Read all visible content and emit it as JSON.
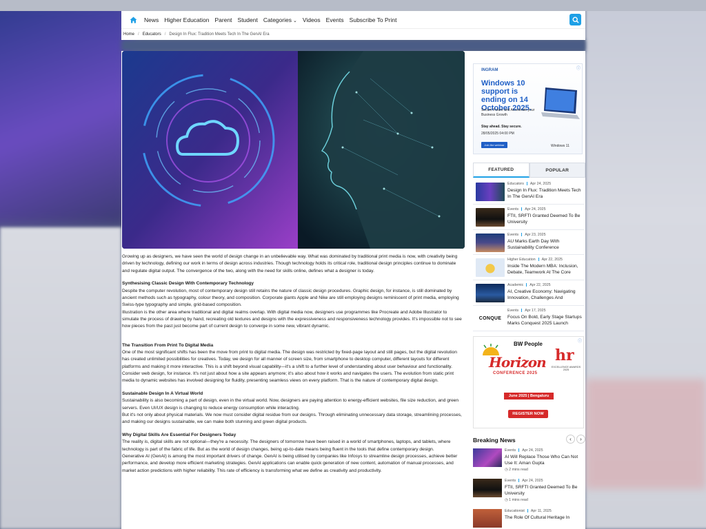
{
  "nav": {
    "items": [
      "News",
      "Higher Education",
      "Parent",
      "Student",
      "Categories",
      "Videos",
      "Events",
      "Subscribe To Print"
    ]
  },
  "breadcrumb": {
    "home": "Home",
    "section": "Educators",
    "current": "Design In Flux: Tradition Meets Tech In The GenAI Era"
  },
  "article": {
    "intro": "Growing up as designers, we have seen the world of design change in an unbelievable way. What was dominated by traditional print media is now, with creativity being driven by technology, defining our work in terms of design across industries. Though technology holds its critical role, traditional design principles continue to dominate and regulate digital output. The convergence of the two, along with the need for skills online, defines what a designer is today.",
    "h1": "Synthesising Classic Design With Contemporary Technology",
    "p1a": "Despite the computer revolution, most of contemporary design still retains the nature of classic design procedures. Graphic design, for instance, is still dominated by ancient methods such as typography, colour theory, and composition. Corporate giants Apple and Nike are still employing designs reminiscent of print media, employing Swiss-type typography and simple, grid-based composition.",
    "p1b": "Illustration is the other area where traditional and digital realms overlap. With digital media now, designers use programmes like Procreate and Adobe Illustrator to simulate the process of drawing by hand, recreating old textures and designs with the expressiveness and responsiveness technology provides. It's impossible not to see how pieces from the past just become part of current design to converge in some new, vibrant dynamic.",
    "h2": "The Transition From Print To Digital Media",
    "p2a": "One of the most significant shifts has been the move from print to digital media. The design was restricted by fixed-page layout and still pages, but the digital revolution has created unlimited possibilities for creatives. Today, we design for all manner of screen size, from smartphone to desktop computer, different layouts for different platforms and making it more interactive. This is a shift beyond visual capability—it's a shift to a further level of understanding about user behaviour and functionality.",
    "p2b": "Consider web design, for instance. It's not just about how a site appears anymore; it's also about how it works and navigates the users. The evolution from static print media to dynamic websites has involved designing for fluidity, presenting seamless views on every platform. That is the nature of contemporary digital design.",
    "h3": "Sustainable Design In A Virtual World",
    "p3a": "Sustainability is also becoming a part of design, even in the virtual world. Now, designers are paying attention to energy-efficient websites, file size reduction, and green servers. Even UI/UX design is changing to reduce energy consumption while interacting.",
    "p3b": "But it's not only about physical materials. We now must consider digital residue from our designs. Through eliminating unnecessary data storage, streamlining processes, and making our designs sustainable, we can make both stunning and green digital products.",
    "h4": "Why Digital Skills Are Essential For Designers Today",
    "p4a": "The reality is, digital skills are not optional—they're a necessity. The designers of tomorrow have been raised in a world of smartphones, laptops, and tablets, where technology is part of the fabric of life. But as the world of design changes, being up-to-date means being fluent in the tools that define contemporary design.",
    "p4b": "Generative AI (GenAI) is among the most important drivers of change. GenAI is being utilised by companies like Infosys to streamline design processes, achieve better performance, and develop more efficient marketing strategies. GenAI applications can enable quick generation of new content, automation of manual processes, and market action predictions with higher reliability. This rate of efficiency is transforming what we define as creativity and productivity."
  },
  "ad1": {
    "brand": "INGRAM",
    "headline": "Windows 10 support is ending on 14 October 2025.",
    "sub": "Secure Future and Accelerate your Business Growth",
    "stay": "Stay ahead. Stay secure.",
    "date": "28/05/2025   04:00 PM",
    "button": "Join the webinar",
    "win": "Windows 11"
  },
  "tabs": {
    "featured": "FEATURED",
    "popular": "POPULAR"
  },
  "featured": [
    {
      "cat": "Educators",
      "date": "Apr 24, 2025",
      "title": "Design In Flux: Tradition Meets Tech In The GenAI Era"
    },
    {
      "cat": "Events",
      "date": "Apr 24, 2025",
      "title": "FTII, SRFTI Granted Deemed To Be University"
    },
    {
      "cat": "Events",
      "date": "Apr 23, 2025",
      "title": "AU Marks Earth Day With Sustainability Conference"
    },
    {
      "cat": "Higher Education",
      "date": "Apr 22, 2025",
      "title": "Inside The Modern MBA: Inclusion, Debate, Teamwork At The Core"
    },
    {
      "cat": "Academic",
      "date": "Apr 22, 2025",
      "title": "AI, Creative Economy: Navigating Innovation, Challenges And Opportunities"
    },
    {
      "cat": "Events",
      "date": "Apr 17, 2025",
      "title": "Focus On Bold, Early Stage Startups Marks Conquest 2025 Launch"
    }
  ],
  "ad2": {
    "brand": "BW People",
    "horizon": "Horizon",
    "conf": "CONFERENCE 2025",
    "hr": "hr",
    "hrsub": "EXCELLENCE AWARDS 2025",
    "date": "June 2025 | Bengaluru",
    "register": "REGISTER NOW"
  },
  "breaking": {
    "title": "Breaking News",
    "prev": "‹",
    "next": "›",
    "items": [
      {
        "cat": "Events",
        "date": "Apr 24, 2025",
        "title": "AI Will Replace Those Who Can Not Use It: Aman Gupta",
        "read": "2 mins read"
      },
      {
        "cat": "Events",
        "date": "Apr 24, 2025",
        "title": "FTII, SRFTI Granted Deemed To Be University",
        "read": "1 mins read"
      },
      {
        "cat": "Educationist",
        "date": "Apr 11, 2025",
        "title": "The Role Of Cultural Heritage In",
        "read": ""
      }
    ]
  },
  "colors": {
    "accent": "#1ea0e6",
    "adRed": "#d62a2a",
    "adBlue": "#1f5fc6"
  }
}
